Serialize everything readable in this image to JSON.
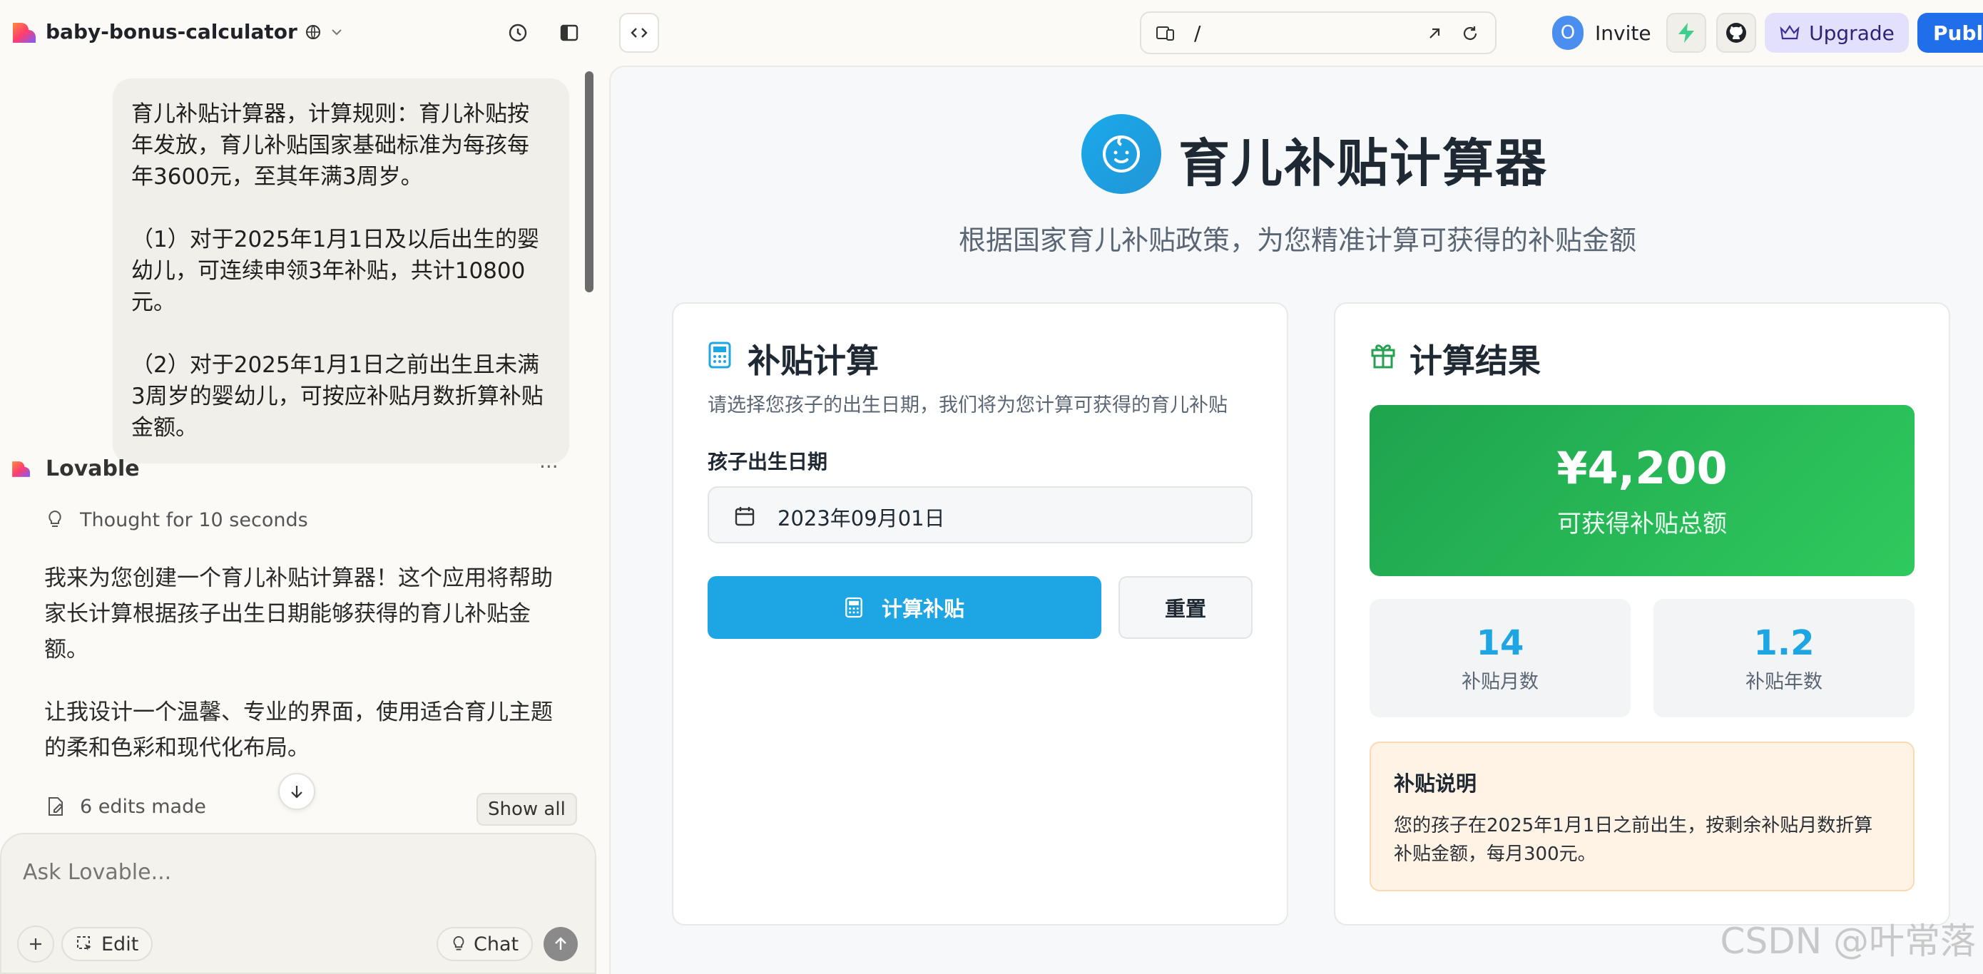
{
  "topbar": {
    "project_name": "baby-bonus-calculator",
    "url_path": "/",
    "avatar_letter": "O",
    "invite_label": "Invite",
    "upgrade_label": "Upgrade",
    "publish_label": "Publi"
  },
  "chat": {
    "user_message": {
      "p1": "育儿补贴计算器，计算规则：育儿补贴按年发放，育儿补贴国家基础标准为每孩每年3600元，至其年满3周岁。",
      "p2": "（1）对于2025年1月1日及以后出生的婴幼儿，可连续申领3年补贴，共计10800元。",
      "p3": "（2）对于2025年1月1日之前出生且未满3周岁的婴幼儿，可按应补贴月数折算补贴金额。"
    },
    "bot_name": "Lovable",
    "more_label": "···",
    "thought_label": "Thought for 10 seconds",
    "bot_p1": "我来为您创建一个育儿补贴计算器！这个应用将帮助家长计算根据孩子出生日期能够获得的育儿补贴金额。",
    "bot_p2": "让我设计一个温馨、专业的界面，使用适合育儿主题的柔和色彩和现代化布局。",
    "edits_label": "6 edits made",
    "show_all_label": "Show all",
    "composer_placeholder": "Ask Lovable...",
    "edit_label": "Edit",
    "chat_label": "Chat"
  },
  "app": {
    "title": "育儿补贴计算器",
    "subtitle": "根据国家育儿补贴政策，为您精准计算可获得的补贴金额",
    "calc_card": {
      "title": "补贴计算",
      "desc": "请选择您孩子的出生日期，我们将为您计算可获得的育儿补贴",
      "field_label": "孩子出生日期",
      "date_value": "2023年09月01日",
      "calc_button": "计算补贴",
      "reset_button": "重置"
    },
    "result_card": {
      "title": "计算结果",
      "total_amount": "¥4,200",
      "total_label": "可获得补贴总额",
      "months_value": "14",
      "months_label": "补贴月数",
      "years_value": "1.2",
      "years_label": "补贴年数",
      "note_title": "补贴说明",
      "note_text": "您的孩子在2025年1月1日之前出生，按剩余补贴月数折算补贴金额，每月300元。"
    }
  },
  "watermark": "CSDN @叶常落",
  "colors": {
    "accent_blue": "#1ea5e3",
    "result_green": "#26b355",
    "upgrade_bg": "#e3e0fb",
    "publish_bg": "#1f6feb"
  }
}
